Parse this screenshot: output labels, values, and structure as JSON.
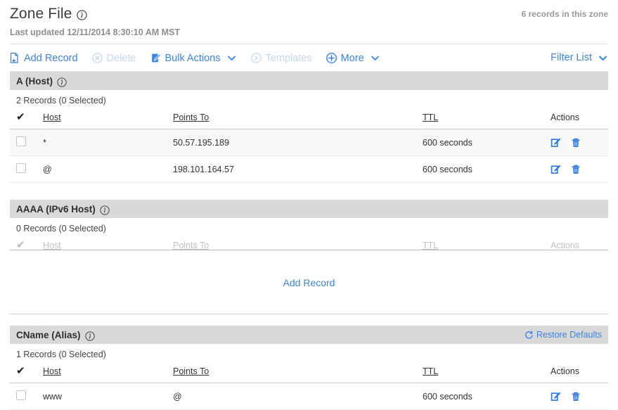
{
  "header": {
    "title": "Zone File",
    "info_icon": "info-icon",
    "records_summary": "6 records in this zone",
    "last_updated": "Last updated 12/11/2014 8:30:10 AM MST"
  },
  "toolbar": {
    "items": [
      {
        "label": "Add Record",
        "icon": "document-add-icon",
        "disabled": false,
        "chevron": false
      },
      {
        "label": "Delete",
        "icon": "circle-x-icon",
        "disabled": true,
        "chevron": false
      },
      {
        "label": "Bulk Actions",
        "icon": "clipboard-edit-icon",
        "disabled": false,
        "chevron": true
      },
      {
        "label": "Templates",
        "icon": "circle-arrow-icon",
        "disabled": true,
        "chevron": false
      },
      {
        "label": "More",
        "icon": "circle-plus-icon",
        "disabled": false,
        "chevron": true
      }
    ],
    "filter_label": "Filter List",
    "filter_chevron": "chevron-down-icon"
  },
  "columns": {
    "check": "✔",
    "host": "Host",
    "points_to": "Points To",
    "ttl": "TTL",
    "actions": "Actions"
  },
  "sections": [
    {
      "id": "a-host",
      "title": "A (Host)",
      "count_label": "2 Records (0 Selected)",
      "restore_label": null,
      "empty": false,
      "rows": [
        {
          "host": "*",
          "points_to": "50.57.195.189",
          "ttl": "600 seconds"
        },
        {
          "host": "@",
          "points_to": "198.101.164.57",
          "ttl": "600 seconds"
        }
      ]
    },
    {
      "id": "aaaa-ipv6-host",
      "title": "AAAA (IPv6 Host)",
      "count_label": "0 Records (0 Selected)",
      "restore_label": null,
      "empty": true,
      "empty_action": "Add Record",
      "rows": []
    },
    {
      "id": "cname-alias",
      "title": "CName (Alias)",
      "count_label": "1 Records (0 Selected)",
      "restore_label": "Restore Defaults",
      "restore_icon": "refresh-icon",
      "empty": false,
      "rows": [
        {
          "host": "www",
          "points_to": "@",
          "ttl": "600 seconds"
        }
      ]
    }
  ],
  "row_actions": {
    "edit": "edit-icon",
    "delete": "trash-icon"
  },
  "colors": {
    "link": "#3b84e8",
    "disabled_link": "#c6d6ec",
    "section_bar": "#d9d9d9",
    "alt_row": "#f8f8f8"
  }
}
